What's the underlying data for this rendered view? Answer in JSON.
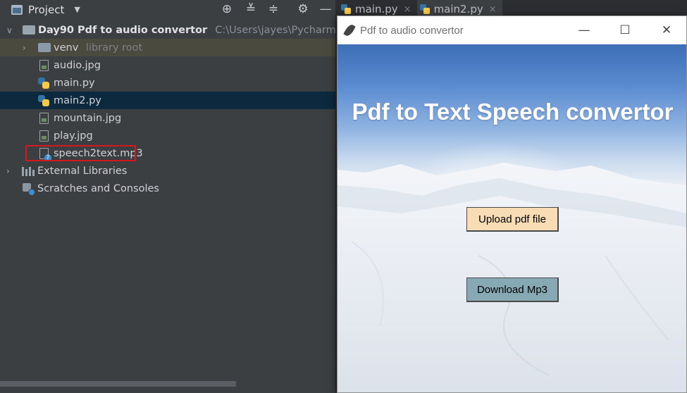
{
  "project_panel": {
    "title": "Project",
    "root": {
      "name": "Day90 Pdf to audio convertor",
      "path": "C:\\Users\\jayes\\PycharmProjects\\"
    },
    "items": [
      {
        "name": "venv",
        "extra": "library root"
      },
      {
        "name": "audio.jpg"
      },
      {
        "name": "main.py"
      },
      {
        "name": "main2.py"
      },
      {
        "name": "mountain.jpg"
      },
      {
        "name": "play.jpg"
      },
      {
        "name": "speech2text.mp3"
      }
    ],
    "external_libraries": "External Libraries",
    "scratches": "Scratches and Consoles"
  },
  "editor_tabs": [
    {
      "label": "main.py",
      "close": "×"
    },
    {
      "label": "main2.py",
      "close": "×"
    }
  ],
  "app_window": {
    "title": "Pdf to audio convertor",
    "heading": "Pdf to Text Speech convertor",
    "upload_label": "Upload pdf file",
    "download_label": "Download Mp3",
    "upload_color": "#f7dcb4",
    "download_color": "#86a9b4"
  },
  "icons": {
    "minimize": "—",
    "maximize": "☐",
    "close": "✕"
  }
}
